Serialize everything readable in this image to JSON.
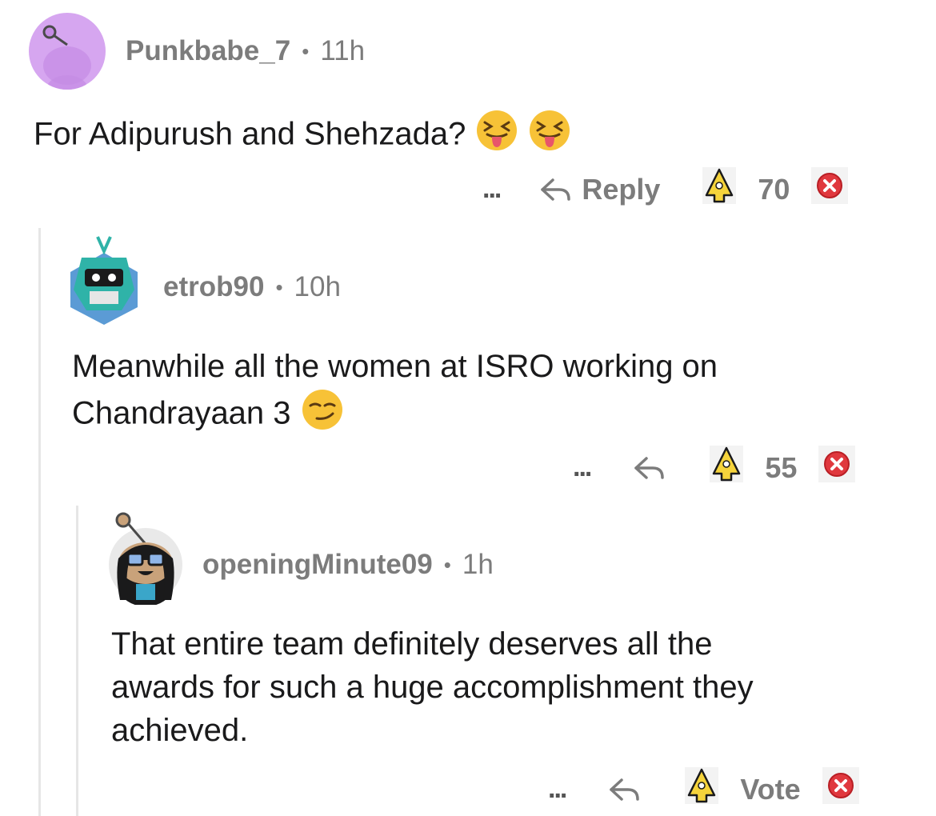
{
  "comments": [
    {
      "username": "Punkbabe_7",
      "separator": "•",
      "time": "11h",
      "text": "For Adipurush and Shehzada?",
      "emojis": [
        "squinting-tongue-emoji",
        "squinting-tongue-emoji"
      ],
      "more": "...",
      "reply_label": "Reply",
      "votes": "70"
    },
    {
      "username": "etrob90",
      "separator": "•",
      "time": "10h",
      "text_line1": "Meanwhile all the women at ISRO working on",
      "text_line2": "Chandrayaan 3",
      "emojis": [
        "smirking-face-emoji"
      ],
      "more": "...",
      "votes": "55"
    },
    {
      "username": "openingMinute09",
      "separator": "•",
      "time": "1h",
      "text_line1": "That entire team definitely deserves all the",
      "text_line2": "awards for such a huge accomplishment they",
      "text_line3": "achieved.",
      "more": "...",
      "votes": "Vote"
    }
  ],
  "colors": {
    "meta_text": "#7c7c7c",
    "body_text": "#1a1a1b",
    "thread_line": "#e6e6e6",
    "avatar1_bg": "#d6a6f0",
    "downvote_red": "#e0383e",
    "award_yellow": "#f5d33b"
  }
}
